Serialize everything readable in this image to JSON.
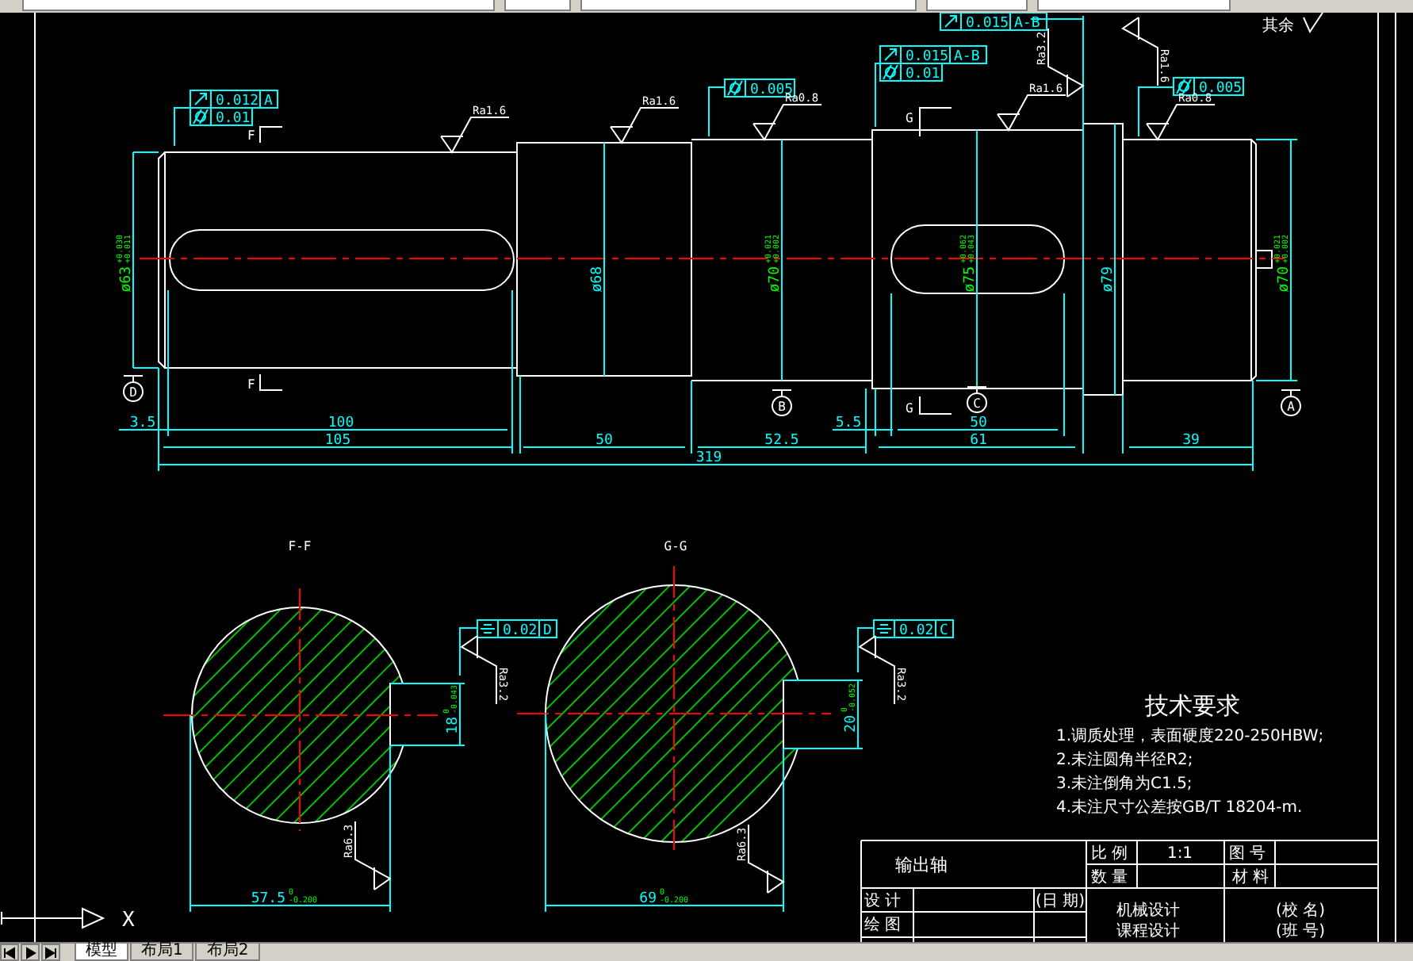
{
  "main_view": {
    "tolerance_frames": [
      {
        "kind": "runout",
        "value": "0.012",
        "datum": "A"
      },
      {
        "kind": "cylindricity",
        "value": "0.01"
      },
      {
        "kind": "cylindricity",
        "value": "0.005"
      },
      {
        "kind": "runout",
        "value": "0.015",
        "datum": "A-B"
      },
      {
        "kind": "cylindricity",
        "value": "0.01"
      },
      {
        "kind": "runout",
        "value": "0.015",
        "datum": "A-B"
      },
      {
        "kind": "cylindricity",
        "value": "0.005"
      }
    ],
    "roughness": [
      "Ra1.6",
      "Ra1.6",
      "Ra0.8",
      "Ra1.6",
      "Ra3.2",
      "Ra1.6",
      "Ra0.8"
    ],
    "section_marks": [
      "F",
      "F",
      "G",
      "G"
    ],
    "diameters": [
      {
        "text": "ø63",
        "tolerance": [
          "+0.030",
          "+0.011"
        ]
      },
      {
        "text": "ø68"
      },
      {
        "text": "ø70",
        "tolerance": [
          "+0.021",
          "+0.002"
        ]
      },
      {
        "text": "ø75",
        "tolerance": [
          "+0.062",
          "+0.043"
        ]
      },
      {
        "text": "ø79"
      },
      {
        "text": "ø70",
        "tolerance": [
          "+0.021",
          "+0.002"
        ]
      }
    ],
    "datums": [
      "D",
      "B",
      "C",
      "A"
    ],
    "lengths": [
      "3.5",
      "100",
      "105",
      "50",
      "52.5",
      "5.5",
      "50",
      "61",
      "39",
      "319"
    ],
    "other_surfaces": "其余"
  },
  "sections": [
    {
      "title": "F-F",
      "tolerance_frame": {
        "kind": "symmetry",
        "value": "0.02",
        "datum": "D"
      },
      "roughness": [
        "Ra3.2",
        "Ra6.3"
      ],
      "key_width": {
        "text": "18",
        "tolerance": [
          "0",
          "-0.043"
        ]
      },
      "depth": {
        "text": "57.5",
        "tolerance": [
          "0",
          "-0.200"
        ]
      }
    },
    {
      "title": "G-G",
      "tolerance_frame": {
        "kind": "symmetry",
        "value": "0.02",
        "datum": "C"
      },
      "roughness": [
        "Ra3.2",
        "Ra6.3"
      ],
      "key_width": {
        "text": "20",
        "tolerance": [
          "0",
          "-0.052"
        ]
      },
      "depth": {
        "text": "69",
        "tolerance": [
          "0",
          "-0.200"
        ]
      }
    }
  ],
  "technical_requirements": {
    "title": "技术要求",
    "items": [
      "1.调质处理，表面硬度220-250HBW;",
      "2.未注圆角半径R2;",
      "3.未注倒角为C1.5;",
      "4.未注尺寸公差按GB/T 18204-m."
    ]
  },
  "title_block": {
    "part_name": "输出轴",
    "cells": [
      "比 例",
      "1:1",
      "图 号",
      "数 量",
      "材 料",
      "设 计",
      "(日 期)",
      "绘 图",
      "机械设计",
      "课程设计",
      "(校 名)",
      "(班 号)"
    ]
  },
  "ucs": {
    "axis_label": "X"
  },
  "tabs": [
    {
      "label": "模型",
      "selected": true
    },
    {
      "label": "布局1",
      "selected": false
    },
    {
      "label": "布局2",
      "selected": false
    }
  ]
}
